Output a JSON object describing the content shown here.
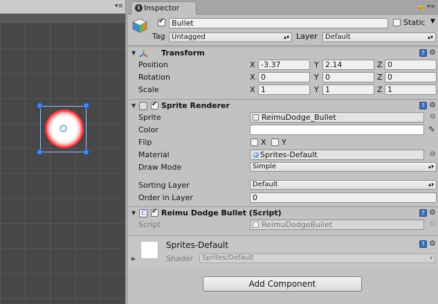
{
  "scene": {
    "menu_icon": "panel-menu-icon"
  },
  "inspector": {
    "tab_label": "Inspector",
    "tab_icon": "info-icon",
    "lock_icon": "lock-icon",
    "menu_icon": "panel-menu-icon"
  },
  "object": {
    "active": true,
    "name": "Bullet",
    "static_label": "Static",
    "static": false,
    "tag_label": "Tag",
    "tag_value": "Untagged",
    "layer_label": "Layer",
    "layer_value": "Default"
  },
  "transform": {
    "title": "Transform",
    "position": {
      "label": "Position",
      "x": "-3.37",
      "y": "2.14",
      "z": "0"
    },
    "rotation": {
      "label": "Rotation",
      "x": "0",
      "y": "0",
      "z": "0"
    },
    "scale": {
      "label": "Scale",
      "x": "1",
      "y": "1",
      "z": "1"
    },
    "axis": {
      "x": "X",
      "y": "Y",
      "z": "Z"
    }
  },
  "sprite_renderer": {
    "title": "Sprite Renderer",
    "enabled": true,
    "sprite_label": "Sprite",
    "sprite_value": "ReimuDodge_Bullet",
    "color_label": "Color",
    "color_value": "#ffffff",
    "flip_label": "Flip",
    "flip_x_label": "X",
    "flip_y_label": "Y",
    "material_label": "Material",
    "material_value": "Sprites-Default",
    "draw_mode_label": "Draw Mode",
    "draw_mode_value": "Simple",
    "sorting_layer_label": "Sorting Layer",
    "sorting_layer_value": "Default",
    "order_label": "Order in Layer",
    "order_value": "0"
  },
  "script_comp": {
    "title": "Reimu Dodge Bullet (Script)",
    "enabled": true,
    "script_label": "Script",
    "script_value": "ReimuDodgeBullet"
  },
  "material": {
    "name": "Sprites-Default",
    "shader_label": "Shader",
    "shader_value": "Sprites/Default"
  },
  "add_component_label": "Add Component"
}
